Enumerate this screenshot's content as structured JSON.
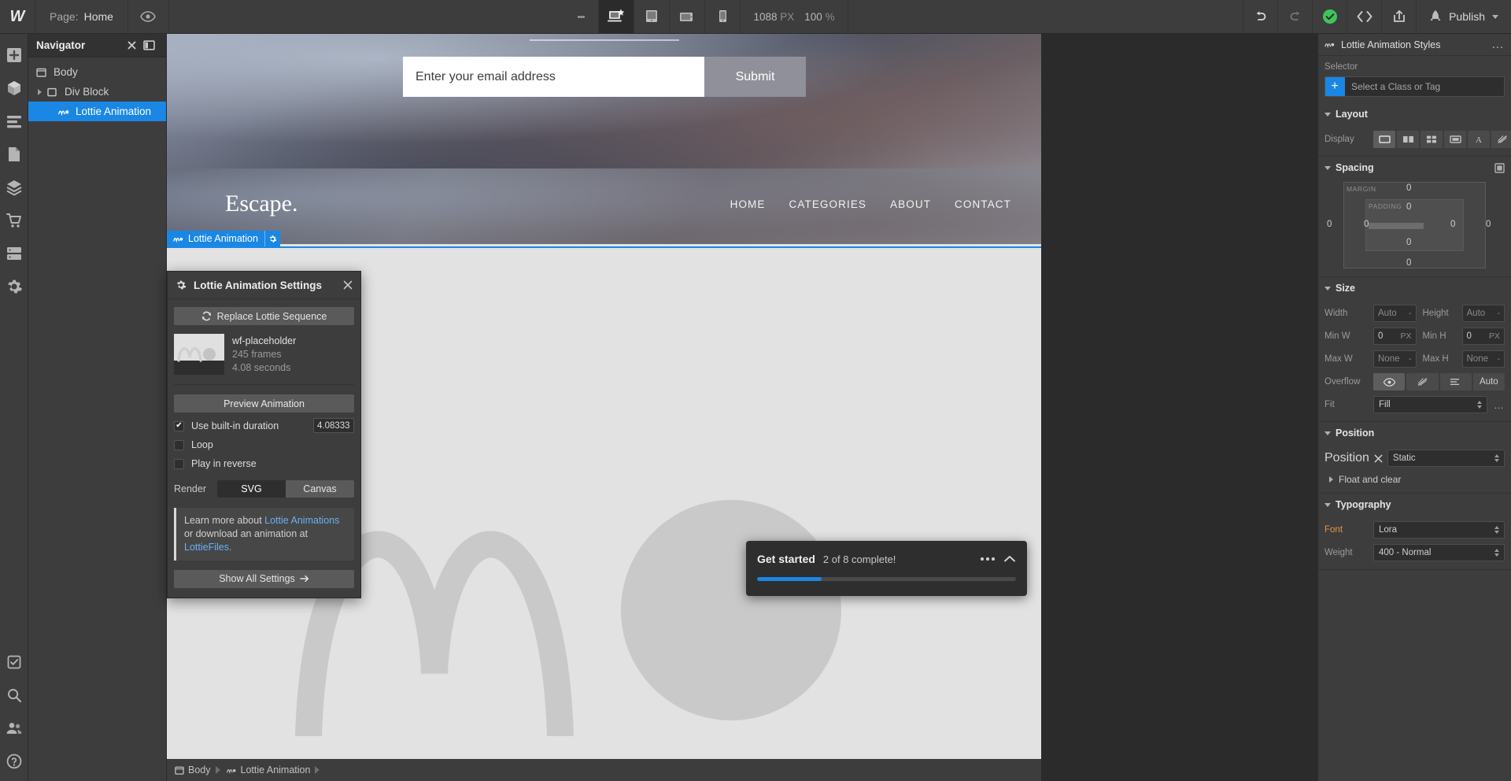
{
  "topbar": {
    "logo": "W",
    "page_label": "Page:",
    "page_name": "Home",
    "eye_icon": "preview-eye-icon",
    "more_icon": "more-vertical-icon",
    "breakpoints": [
      {
        "name": "desktop",
        "icon": "desktop-star-icon",
        "active": true
      },
      {
        "name": "tablet",
        "icon": "tablet-icon",
        "active": false
      },
      {
        "name": "tablet-landscape",
        "icon": "tablet-landscape-icon",
        "active": false
      },
      {
        "name": "mobile",
        "icon": "mobile-icon",
        "active": false
      }
    ],
    "canvas_width": "1088",
    "canvas_width_unit": "PX",
    "zoom_value": "100",
    "zoom_unit": "%",
    "undo_icon": "undo-icon",
    "redo_icon": "redo-icon",
    "save_status_icon": "check-circle-icon",
    "save_status_color": "#3ec65a",
    "code_icon": "code-brackets-icon",
    "share_icon": "share-export-icon",
    "publish_icon": "rocket-icon",
    "publish_label": "Publish"
  },
  "left_rail": {
    "items": [
      {
        "name": "add-elements",
        "icon": "plus-icon"
      },
      {
        "name": "components",
        "icon": "cube-icon"
      },
      {
        "name": "style-manager",
        "icon": "list-lines-icon"
      },
      {
        "name": "pages",
        "icon": "page-icon"
      },
      {
        "name": "assets",
        "icon": "layers-icon"
      },
      {
        "name": "ecommerce",
        "icon": "cart-icon"
      },
      {
        "name": "cms",
        "icon": "database-icon"
      },
      {
        "name": "settings",
        "icon": "gear-icon"
      }
    ],
    "bottom_items": [
      {
        "name": "audit",
        "icon": "checklist-icon"
      },
      {
        "name": "search",
        "icon": "search-icon"
      },
      {
        "name": "collaborators",
        "icon": "people-icon"
      },
      {
        "name": "help",
        "icon": "help-circle-icon"
      }
    ]
  },
  "navigator": {
    "title": "Navigator",
    "close_icon": "collapse-chevron-icon",
    "dock_icon": "panel-dock-icon",
    "items": [
      {
        "label": "Body",
        "icon": "body-icon",
        "indent": 0,
        "selected": false,
        "expandable": false
      },
      {
        "label": "Div Block",
        "icon": "div-block-icon",
        "indent": 1,
        "selected": false,
        "expandable": true
      },
      {
        "label": "Lottie Animation",
        "icon": "lottie-icon",
        "indent": 2,
        "selected": true,
        "expandable": false
      }
    ]
  },
  "canvas": {
    "email_placeholder": "Enter your email address",
    "email_value": "",
    "submit_label": "Submit",
    "brand": "Escape.",
    "nav_links": [
      "HOME",
      "CATEGORIES",
      "ABOUT",
      "CONTACT"
    ],
    "selection_badge_label": "Lottie Animation",
    "selection_badge_icon": "lottie-icon",
    "selection_gear_icon": "gear-icon",
    "selection_color": "#1a87e5",
    "breadcrumb": [
      {
        "label": "Body",
        "icon": "body-icon"
      },
      {
        "label": "Lottie Animation",
        "icon": "lottie-icon"
      }
    ]
  },
  "modal": {
    "title": "Lottie Animation Settings",
    "gear_icon": "gear-icon",
    "close_icon": "close-icon",
    "replace_label": "Replace Lottie Sequence",
    "replace_icon": "refresh-icon",
    "file_name": "wf-placeholder",
    "file_frames": "245 frames",
    "file_duration": "4.08 seconds",
    "preview_label": "Preview Animation",
    "options": [
      {
        "label": "Use built-in duration",
        "checked": true
      },
      {
        "label": "Loop",
        "checked": false
      },
      {
        "label": "Play in reverse",
        "checked": false
      }
    ],
    "duration_value": "4.08333",
    "render_label": "Render",
    "render_options": [
      {
        "label": "SVG",
        "active": true
      },
      {
        "label": "Canvas",
        "active": false
      }
    ],
    "info_prefix": "Learn more about ",
    "info_link1": "Lottie Animations",
    "info_middle": " or download an animation at ",
    "info_link2": "LottieFiles.",
    "show_all_label": "Show All Settings",
    "show_all_icon": "arrow-right-icon"
  },
  "toast": {
    "title": "Get started",
    "subtitle": "2 of 8 complete!",
    "progress_percent": 25,
    "progress_color": "#1a87e5",
    "more_icon": "more-horizontal-icon",
    "collapse_icon": "chevron-up-icon"
  },
  "right_panel": {
    "tabs": [
      {
        "name": "style",
        "icon": "paintbrush-icon",
        "active": true
      },
      {
        "name": "settings",
        "icon": "gear-icon",
        "active": false
      },
      {
        "name": "interactions",
        "icon": "interactions-icon",
        "active": false
      },
      {
        "name": "effects",
        "icon": "lightning-icon",
        "active": false
      }
    ],
    "header_title": "Lottie Animation Styles",
    "header_icon": "lottie-icon",
    "header_more": "…",
    "selector_label": "Selector",
    "selector_placeholder": "Select a Class or Tag",
    "selector_plus": "+",
    "selector_accent": "#1a87e5",
    "layout": {
      "title": "Layout",
      "display_label": "Display",
      "display_options": [
        {
          "name": "block",
          "icon": "display-block-icon",
          "active": true
        },
        {
          "name": "flex",
          "icon": "display-flex-icon",
          "active": false
        },
        {
          "name": "grid",
          "icon": "display-grid-icon",
          "active": false
        },
        {
          "name": "inline-block",
          "icon": "display-inline-block-icon",
          "active": false
        },
        {
          "name": "inline",
          "icon": "display-inline-icon",
          "active": false
        },
        {
          "name": "none",
          "icon": "display-none-icon",
          "active": false
        }
      ]
    },
    "spacing": {
      "title": "Spacing",
      "margin_label": "MARGIN",
      "padding_label": "PADDING",
      "margin_top": "0",
      "margin_right": "0",
      "margin_bottom": "0",
      "margin_left": "0",
      "padding_top": "0",
      "padding_right": "0",
      "padding_bottom": "0",
      "padding_left": "0",
      "toggle_icon": "spacing-toggle-icon"
    },
    "size": {
      "title": "Size",
      "width_label": "Width",
      "width_value": "Auto",
      "height_label": "Height",
      "height_value": "Auto",
      "minw_label": "Min W",
      "minw_value": "0",
      "minw_unit": "PX",
      "minh_label": "Min H",
      "minh_value": "0",
      "minh_unit": "PX",
      "maxw_label": "Max W",
      "maxw_value": "None",
      "maxh_label": "Max H",
      "maxh_value": "None",
      "overflow_label": "Overflow",
      "overflow_options": [
        {
          "name": "visible",
          "icon": "eye-icon",
          "active": true
        },
        {
          "name": "hidden",
          "icon": "hidden-icon",
          "active": false
        },
        {
          "name": "scroll",
          "icon": "scroll-icon",
          "active": false
        },
        {
          "name": "auto",
          "label": "Auto",
          "active": false
        }
      ],
      "fit_label": "Fit",
      "fit_value": "Fill",
      "fit_more": "…"
    },
    "position": {
      "title": "Position",
      "position_label": "Position",
      "position_value": "Static",
      "position_clear_icon": "close-x-icon",
      "float_label": "Float and clear"
    },
    "typography": {
      "title": "Typography",
      "font_label": "Font",
      "font_value": "Lora",
      "weight_label": "Weight",
      "weight_value": "400 - Normal"
    }
  }
}
